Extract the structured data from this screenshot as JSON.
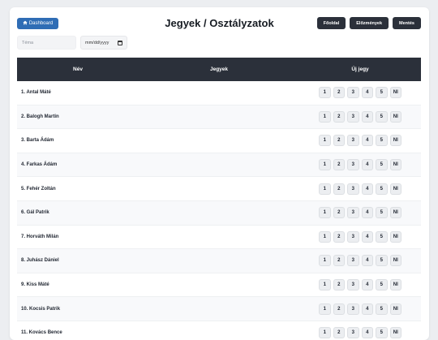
{
  "header": {
    "dashboard_label": "Dashboard",
    "title": "Jegyek / Osztályzatok",
    "actions": [
      "Főoldal",
      "Előzmények",
      "Mentés"
    ]
  },
  "filters": {
    "topic_placeholder": "Téma",
    "date_value": "mm/dd/yyyy"
  },
  "table": {
    "headers": {
      "name": "Név",
      "grades": "Jegyek",
      "new_grade": "Új jegy"
    },
    "grade_options": [
      "1",
      "2",
      "3",
      "4",
      "5",
      "NI"
    ],
    "students": [
      "1. Antal Máté",
      "2. Balogh Martin",
      "3. Barta Ádám",
      "4. Farkas Ádám",
      "5. Fehér Zoltán",
      "6. Gál Patrik",
      "7. Horváth Milán",
      "8. Juhász Dániel",
      "9. Kiss Máté",
      "10. Kocsis Patrik",
      "11. Kovács Bence"
    ]
  },
  "colors": {
    "accent": "#2f6db5",
    "dark": "#2b303a",
    "background": "#eceef1"
  }
}
